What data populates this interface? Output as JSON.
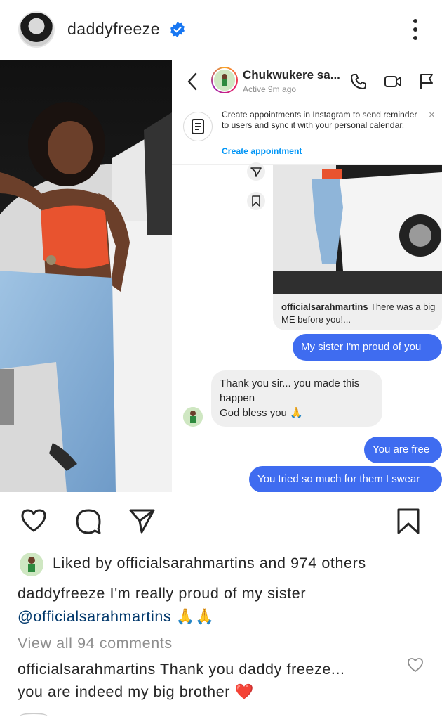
{
  "post_header": {
    "username": "daddyfreeze"
  },
  "dm": {
    "contact_name": "Chukwukere sa...",
    "status": "Active 9m ago",
    "banner_text": "Create appointments in Instagram to send reminder to users and sync it with your personal calendar.",
    "banner_link": "Create appointment",
    "banner_close": "×",
    "shared_post": {
      "caption_user": "officialsarahmartins",
      "caption_text": " There was a big ME before you!..."
    },
    "messages": [
      {
        "direction": "out",
        "text": "My sister I'm proud of you"
      },
      {
        "direction": "in",
        "text": "Thank you sir... you made this happen\nGod bless you 🙏"
      },
      {
        "direction": "out",
        "text": "You are free"
      },
      {
        "direction": "out",
        "text": "You tried so much for them I swear"
      }
    ]
  },
  "likes": {
    "prefix": "Liked by ",
    "user": "officialsarahmartins",
    "suffix": " and 974 others"
  },
  "caption": {
    "user": "daddyfreeze",
    "text": " I'm really proud of my sister",
    "mention": "@officialsarahmartins",
    "emoji": " 🙏🙏"
  },
  "comments": {
    "view_all": "View all 94 comments",
    "top_comment_user": "officialsarahmartins",
    "top_comment_line1": " Thank you daddy freeze...",
    "top_comment_line2": "you are indeed my big brother",
    "top_comment_emoji": " ❤️"
  },
  "colors": {
    "accent_blue": "#0095f6",
    "bubble_blue": "#3f6cf0",
    "verified_blue": "#1877f2",
    "heart_red": "#ed4956"
  }
}
